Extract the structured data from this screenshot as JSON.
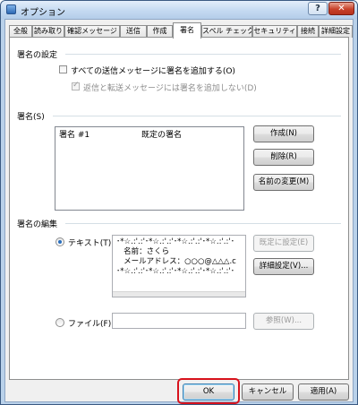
{
  "window": {
    "title": "オプション",
    "help": "?",
    "close": "✕"
  },
  "tabs": [
    "全般",
    "読み取り",
    "確認メッセージ",
    "送信",
    "作成",
    "署名",
    "スペル チェック",
    "セキュリティ",
    "接続",
    "詳細設定"
  ],
  "active_tab": "署名",
  "settings_group": {
    "title": "署名の設定",
    "add_all_label": "すべての送信メッセージに署名を追加する(O)",
    "no_reply_label": "返信と転送メッセージには署名を追加しない(D)"
  },
  "signatures_group": {
    "title": "署名(S)",
    "items": [
      {
        "name": "署名 #1",
        "type": "既定の署名"
      }
    ],
    "buttons": {
      "new": "作成(N)",
      "remove": "削除(R)",
      "rename": "名前の変更(M)"
    }
  },
  "edit_group": {
    "title": "署名の編集",
    "text_label": "テキスト(T)",
    "text_lines": [
      "･*☆.:'.:'･*☆.:'.:'･*☆.:'.:'･*☆.:'.:'･",
      "   名前：さくら",
      "   メールアドレス：○○○@△△△.c",
      "･*☆.:'.:'･*☆.:'.:'･*☆.:'.:'･*☆.:'.:'･"
    ],
    "set_default": "既定に設定(E)",
    "advanced": "詳細設定(V)...",
    "file_label": "ファイル(F)",
    "browse": "参照(W)..."
  },
  "footer": {
    "ok": "OK",
    "cancel": "キャンセル",
    "apply": "適用(A)"
  },
  "colors": {
    "highlight": "#d8121c",
    "accent": "#2a6fbd"
  }
}
